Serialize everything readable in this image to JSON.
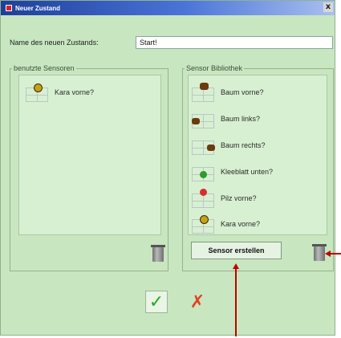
{
  "window": {
    "title": "Neuer Zustand",
    "close_glyph": "x"
  },
  "name_field": {
    "label": "Name des neuen Zustands:",
    "value": "Start!"
  },
  "used_sensors": {
    "legend": "benutzte Sensoren",
    "items": [
      {
        "label": "Kara vorne?",
        "icon": "kara-bug-icon"
      }
    ]
  },
  "library": {
    "legend": "Sensor Bibliothek",
    "items": [
      {
        "label": "Baum vorne?",
        "icon": "tree-front-icon"
      },
      {
        "label": "Baum links?",
        "icon": "tree-left-icon"
      },
      {
        "label": "Baum rechts?",
        "icon": "tree-right-icon"
      },
      {
        "label": "Kleeblatt unten?",
        "icon": "cloverleaf-below-icon"
      },
      {
        "label": "Pilz vorne?",
        "icon": "mushroom-front-icon"
      },
      {
        "label": "Kara vorne?",
        "icon": "kara-front-icon"
      }
    ],
    "create_button": "Sensor erstellen"
  },
  "actions": {
    "ok_glyph": "✓",
    "cancel_glyph": "✗"
  },
  "colors": {
    "dialog_bg": "#c8e6c0",
    "title_bar": "#1e3f9a",
    "ok_green": "#2aa62a",
    "cancel_red": "#e24020",
    "annotation": "#c10000"
  }
}
